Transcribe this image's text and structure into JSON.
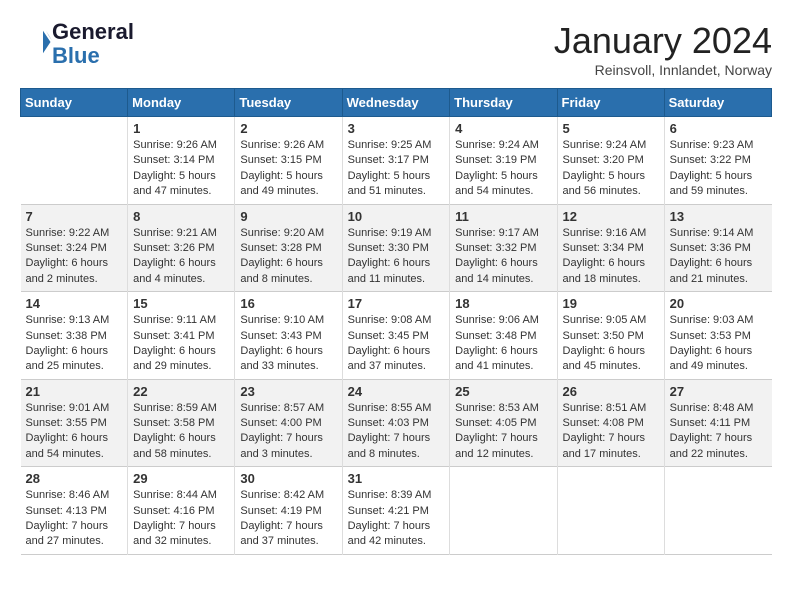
{
  "header": {
    "logo_line1": "General",
    "logo_line2": "Blue",
    "month": "January 2024",
    "location": "Reinsvoll, Innlandet, Norway"
  },
  "days_of_week": [
    "Sunday",
    "Monday",
    "Tuesday",
    "Wednesday",
    "Thursday",
    "Friday",
    "Saturday"
  ],
  "weeks": [
    [
      {
        "day": "",
        "info": ""
      },
      {
        "day": "1",
        "info": "Sunrise: 9:26 AM\nSunset: 3:14 PM\nDaylight: 5 hours\nand 47 minutes."
      },
      {
        "day": "2",
        "info": "Sunrise: 9:26 AM\nSunset: 3:15 PM\nDaylight: 5 hours\nand 49 minutes."
      },
      {
        "day": "3",
        "info": "Sunrise: 9:25 AM\nSunset: 3:17 PM\nDaylight: 5 hours\nand 51 minutes."
      },
      {
        "day": "4",
        "info": "Sunrise: 9:24 AM\nSunset: 3:19 PM\nDaylight: 5 hours\nand 54 minutes."
      },
      {
        "day": "5",
        "info": "Sunrise: 9:24 AM\nSunset: 3:20 PM\nDaylight: 5 hours\nand 56 minutes."
      },
      {
        "day": "6",
        "info": "Sunrise: 9:23 AM\nSunset: 3:22 PM\nDaylight: 5 hours\nand 59 minutes."
      }
    ],
    [
      {
        "day": "7",
        "info": "Sunrise: 9:22 AM\nSunset: 3:24 PM\nDaylight: 6 hours\nand 2 minutes."
      },
      {
        "day": "8",
        "info": "Sunrise: 9:21 AM\nSunset: 3:26 PM\nDaylight: 6 hours\nand 4 minutes."
      },
      {
        "day": "9",
        "info": "Sunrise: 9:20 AM\nSunset: 3:28 PM\nDaylight: 6 hours\nand 8 minutes."
      },
      {
        "day": "10",
        "info": "Sunrise: 9:19 AM\nSunset: 3:30 PM\nDaylight: 6 hours\nand 11 minutes."
      },
      {
        "day": "11",
        "info": "Sunrise: 9:17 AM\nSunset: 3:32 PM\nDaylight: 6 hours\nand 14 minutes."
      },
      {
        "day": "12",
        "info": "Sunrise: 9:16 AM\nSunset: 3:34 PM\nDaylight: 6 hours\nand 18 minutes."
      },
      {
        "day": "13",
        "info": "Sunrise: 9:14 AM\nSunset: 3:36 PM\nDaylight: 6 hours\nand 21 minutes."
      }
    ],
    [
      {
        "day": "14",
        "info": "Sunrise: 9:13 AM\nSunset: 3:38 PM\nDaylight: 6 hours\nand 25 minutes."
      },
      {
        "day": "15",
        "info": "Sunrise: 9:11 AM\nSunset: 3:41 PM\nDaylight: 6 hours\nand 29 minutes."
      },
      {
        "day": "16",
        "info": "Sunrise: 9:10 AM\nSunset: 3:43 PM\nDaylight: 6 hours\nand 33 minutes."
      },
      {
        "day": "17",
        "info": "Sunrise: 9:08 AM\nSunset: 3:45 PM\nDaylight: 6 hours\nand 37 minutes."
      },
      {
        "day": "18",
        "info": "Sunrise: 9:06 AM\nSunset: 3:48 PM\nDaylight: 6 hours\nand 41 minutes."
      },
      {
        "day": "19",
        "info": "Sunrise: 9:05 AM\nSunset: 3:50 PM\nDaylight: 6 hours\nand 45 minutes."
      },
      {
        "day": "20",
        "info": "Sunrise: 9:03 AM\nSunset: 3:53 PM\nDaylight: 6 hours\nand 49 minutes."
      }
    ],
    [
      {
        "day": "21",
        "info": "Sunrise: 9:01 AM\nSunset: 3:55 PM\nDaylight: 6 hours\nand 54 minutes."
      },
      {
        "day": "22",
        "info": "Sunrise: 8:59 AM\nSunset: 3:58 PM\nDaylight: 6 hours\nand 58 minutes."
      },
      {
        "day": "23",
        "info": "Sunrise: 8:57 AM\nSunset: 4:00 PM\nDaylight: 7 hours\nand 3 minutes."
      },
      {
        "day": "24",
        "info": "Sunrise: 8:55 AM\nSunset: 4:03 PM\nDaylight: 7 hours\nand 8 minutes."
      },
      {
        "day": "25",
        "info": "Sunrise: 8:53 AM\nSunset: 4:05 PM\nDaylight: 7 hours\nand 12 minutes."
      },
      {
        "day": "26",
        "info": "Sunrise: 8:51 AM\nSunset: 4:08 PM\nDaylight: 7 hours\nand 17 minutes."
      },
      {
        "day": "27",
        "info": "Sunrise: 8:48 AM\nSunset: 4:11 PM\nDaylight: 7 hours\nand 22 minutes."
      }
    ],
    [
      {
        "day": "28",
        "info": "Sunrise: 8:46 AM\nSunset: 4:13 PM\nDaylight: 7 hours\nand 27 minutes."
      },
      {
        "day": "29",
        "info": "Sunrise: 8:44 AM\nSunset: 4:16 PM\nDaylight: 7 hours\nand 32 minutes."
      },
      {
        "day": "30",
        "info": "Sunrise: 8:42 AM\nSunset: 4:19 PM\nDaylight: 7 hours\nand 37 minutes."
      },
      {
        "day": "31",
        "info": "Sunrise: 8:39 AM\nSunset: 4:21 PM\nDaylight: 7 hours\nand 42 minutes."
      },
      {
        "day": "",
        "info": ""
      },
      {
        "day": "",
        "info": ""
      },
      {
        "day": "",
        "info": ""
      }
    ]
  ]
}
